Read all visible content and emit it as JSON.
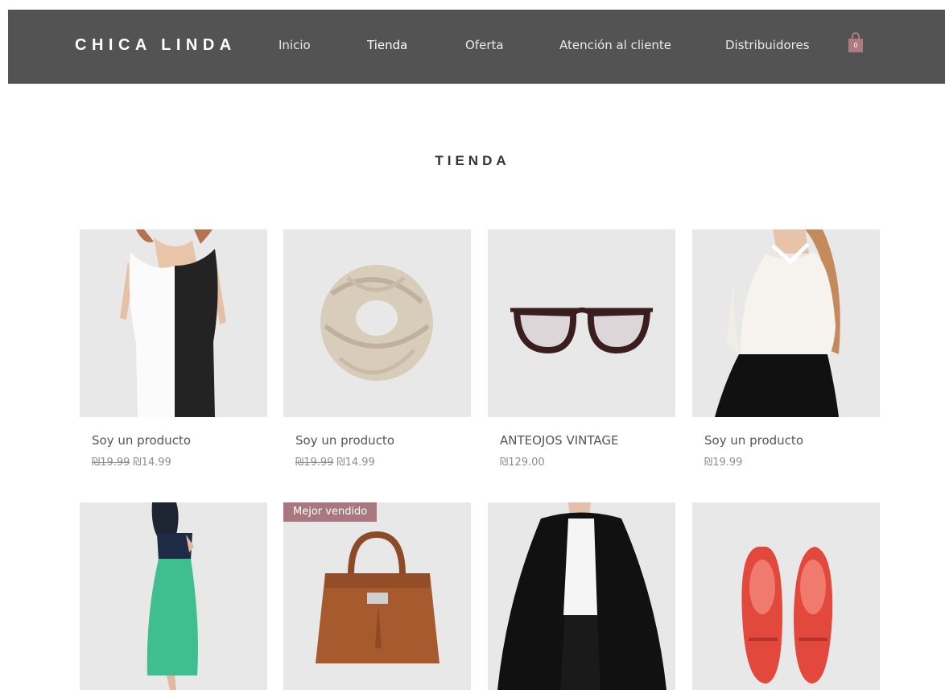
{
  "header": {
    "brand": "CHICA LINDA",
    "nav": [
      {
        "label": "Inicio",
        "active": false
      },
      {
        "label": "Tienda",
        "active": true
      },
      {
        "label": "Oferta",
        "active": false
      },
      {
        "label": "Atención al cliente",
        "active": false
      },
      {
        "label": "Distribuidores",
        "active": false
      }
    ],
    "cart_count": "0",
    "cart_color": "#b07a85"
  },
  "page": {
    "title": "TIENDA"
  },
  "products": [
    {
      "name": "Soy un producto",
      "old_price": "₪19.99",
      "price": "₪14.99",
      "image": "black-white-dress"
    },
    {
      "name": "Soy un producto",
      "old_price": "₪19.99",
      "price": "₪14.99",
      "image": "knit-scarf"
    },
    {
      "name": "ANTEOJOS VINTAGE",
      "old_price": "",
      "price": "₪129.00",
      "image": "vintage-glasses"
    },
    {
      "name": "Soy un producto",
      "old_price": "",
      "price": "₪19.99",
      "image": "lace-blouse"
    },
    {
      "image": "green-skirt"
    },
    {
      "badge": "Mejor vendido",
      "image": "leather-handbag"
    },
    {
      "image": "black-coat"
    },
    {
      "image": "red-loafers"
    }
  ],
  "colors": {
    "header_bg": "#545353",
    "badge_bg": "#a9777f",
    "thumb_bg": "#e8e8e8"
  }
}
